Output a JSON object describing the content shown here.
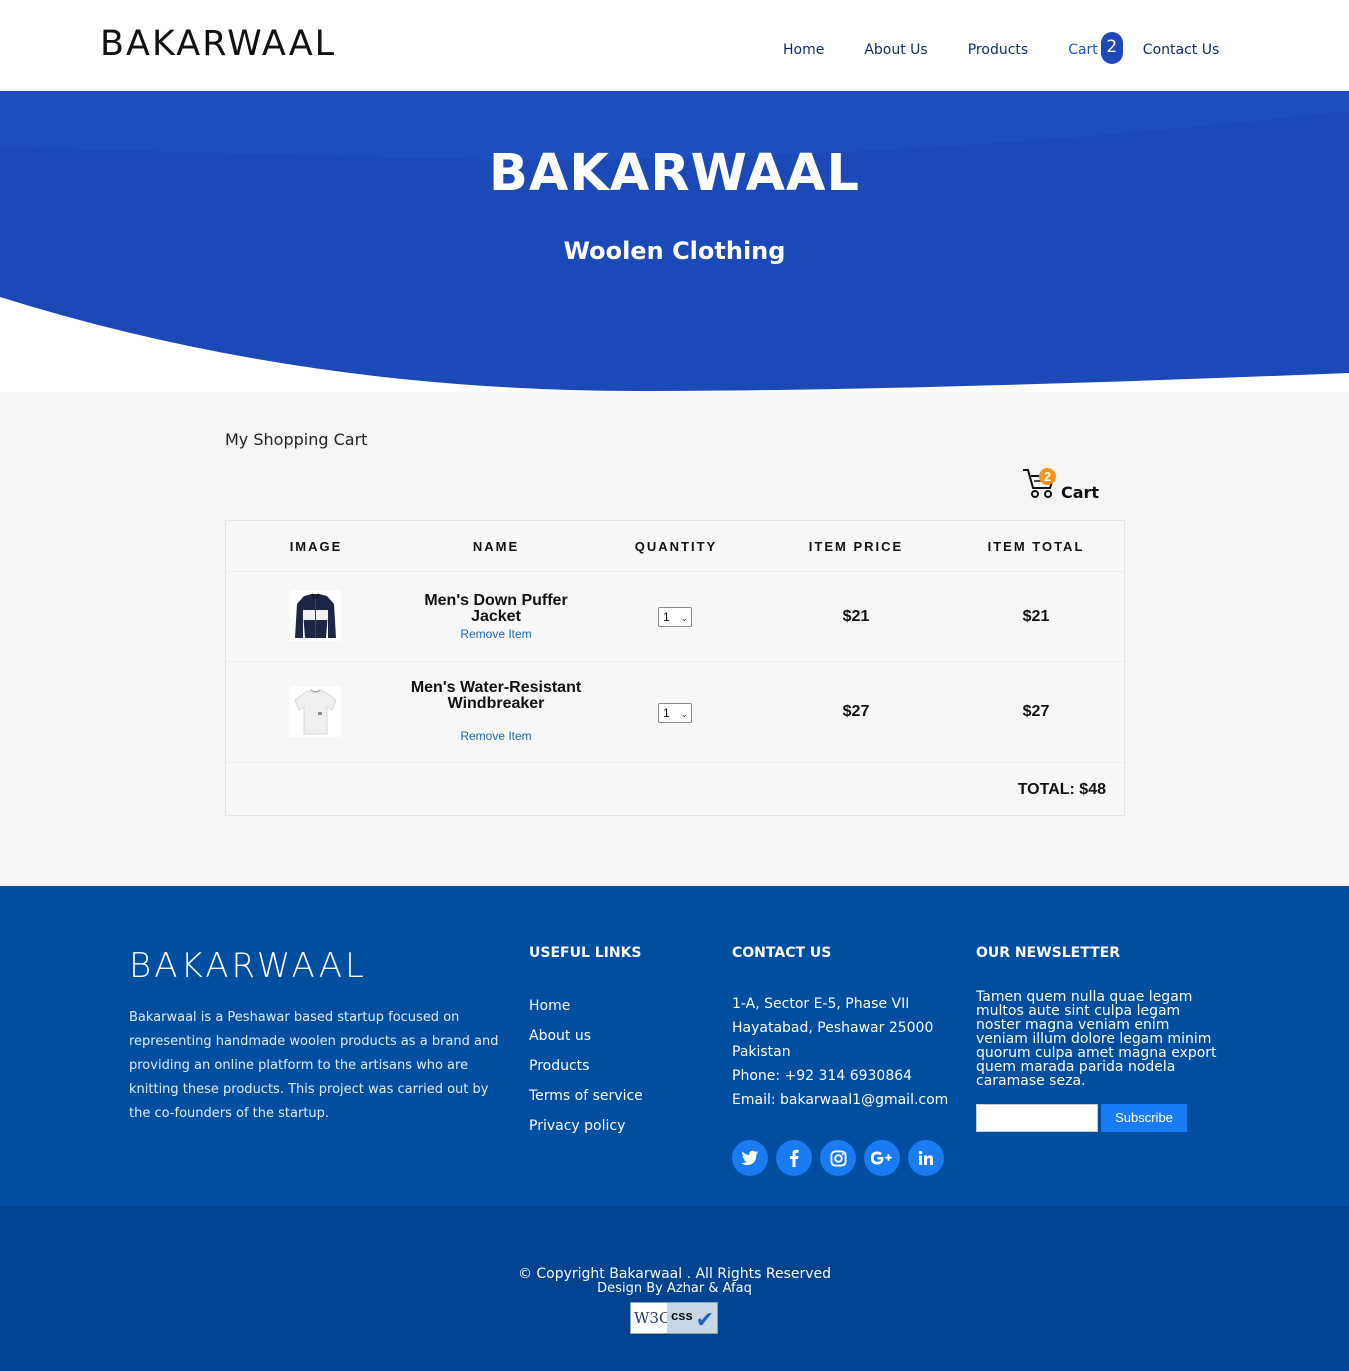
{
  "nav": {
    "brand": "BAKARWAAL",
    "home": "Home",
    "about": "About Us",
    "products": "Products",
    "cart": "Cart",
    "cart_count": "2",
    "contact": "Contact Us"
  },
  "hero": {
    "title": "BAKARWAAL",
    "subtitle": "Woolen Clothing",
    "bg_color": "#1c49b8"
  },
  "cart": {
    "heading": "My Shopping Cart",
    "icon_count": "2",
    "icon_label": "Cart",
    "columns": [
      "IMAGE",
      "NAME",
      "QUANTITY",
      "ITEM PRICE",
      "ITEM TOTAL"
    ],
    "items": [
      {
        "name": "Men's Down Puffer Jacket",
        "remove": "Remove Item",
        "qty": "1",
        "price": "$21",
        "total": "$21"
      },
      {
        "name": "Men's Water-Resistant Windbreaker",
        "remove": "Remove Item",
        "qty": "1",
        "price": "$27",
        "total": "$27"
      }
    ],
    "grand_total": "TOTAL: $48"
  },
  "footer": {
    "brand": "BAKARWAAL",
    "about": "Bakarwaal is a Peshawar based startup focused on representing handmade woolen products as a brand and providing an online platform to the artisans who are knitting these products. This project was carried out by the co-founders of the startup.",
    "links_heading": "USEFUL LINKS",
    "links": [
      "Home",
      "About us",
      "Products",
      "Terms of service",
      "Privacy policy"
    ],
    "contact_heading": "CONTACT US",
    "address1": "1-A, Sector E-5, Phase VII",
    "address2": "Hayatabad, Peshawar 25000",
    "country": "Pakistan",
    "phone": "Phone: +92 314 6930864",
    "email": "Email: bakarwaal1@gmail.com",
    "social_icons": [
      "twitter-icon",
      "facebook-icon",
      "instagram-icon",
      "google-plus-icon",
      "linkedin-icon"
    ],
    "newsletter_heading": "OUR NEWSLETTER",
    "newsletter_text": "Tamen quem nulla quae legam multos aute sint culpa legam noster magna veniam enim veniam illum dolore legam minim quorum culpa amet magna export quem marada parida nodela caramase seza.",
    "subscribe": "Subscribe",
    "copyright": "© Copyright Bakarwaal . All Rights Reserved",
    "design": "Design By Azhar & Afaq",
    "badge_w3c": "W3C",
    "badge_css": "css"
  }
}
